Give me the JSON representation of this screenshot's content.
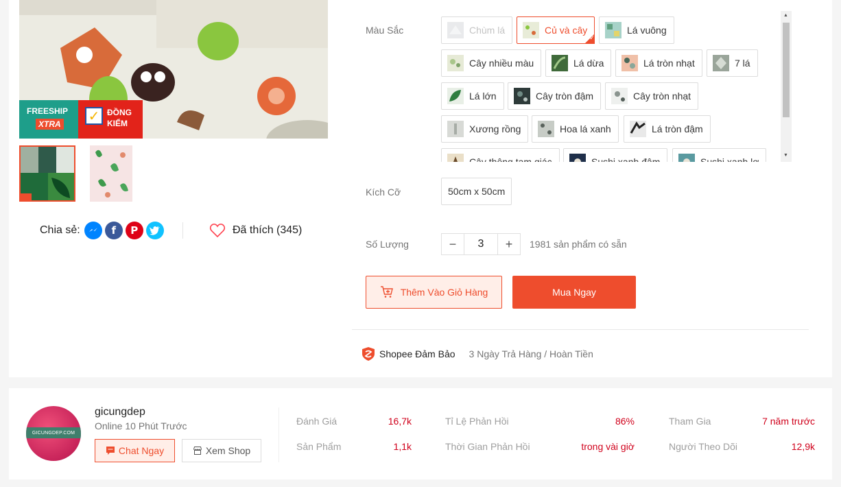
{
  "gallery": {
    "badges": {
      "freeship": "FREESHIP",
      "xtra": "XTRA",
      "dongkiem_1": "ĐỒNG",
      "dongkiem_2": "KIỂM"
    },
    "thumbnail_count": 2
  },
  "share": {
    "label": "Chia sẻ:",
    "networks": [
      "messenger-icon",
      "facebook-icon",
      "pinterest-icon",
      "twitter-icon"
    ]
  },
  "likes": {
    "label": "Đã thích (345)"
  },
  "variation": {
    "label": "Màu Sắc",
    "options": [
      "Chùm lá",
      "Củ và cây",
      "Lá vuông",
      "Cây nhiều màu",
      "Lá dừa",
      "Lá tròn nhạt",
      "7 lá",
      "Lá lớn",
      "Cây tròn đậm",
      "Cây tròn nhạt",
      "Xương rồng",
      "Hoa lá xanh",
      "Lá tròn đậm",
      "Cây thông tam giác",
      "Sushi xanh đậm",
      "Sushi xanh lơ"
    ],
    "selected": "Củ và cây",
    "disabled": [
      "Chùm lá"
    ]
  },
  "size": {
    "label": "Kích Cỡ",
    "option": "50cm x 50cm"
  },
  "quantity": {
    "label": "Số Lượng",
    "minus": "−",
    "value": "3",
    "plus": "+",
    "stock": "1981 sản phẩm có sẵn"
  },
  "actions": {
    "add_to_cart": "Thêm Vào Giỏ Hàng",
    "buy_now": "Mua Ngay"
  },
  "guarantee": {
    "title": "Shopee Đảm Bảo",
    "text": "3 Ngày Trả Hàng / Hoàn Tiền"
  },
  "shop": {
    "name": "gicungdep",
    "online": "Online 10 Phút Trước",
    "avatar_text": "GICUNGDEP.COM",
    "chat_label": "Chat Ngay",
    "view_label": "Xem Shop",
    "stats": [
      {
        "label": "Đánh Giá",
        "value": "16,7k"
      },
      {
        "label": "Sản Phẩm",
        "value": "1,1k"
      },
      {
        "label": "Tỉ Lệ Phản Hồi",
        "value": "86%"
      },
      {
        "label": "Thời Gian Phản Hồi",
        "value": "trong vài giờ"
      },
      {
        "label": "Tham Gia",
        "value": "7 năm trước"
      },
      {
        "label": "Người Theo Dõi",
        "value": "12,9k"
      }
    ]
  },
  "colors": {
    "brand": "#ee4d2d",
    "stat_value": "#d0011b"
  }
}
